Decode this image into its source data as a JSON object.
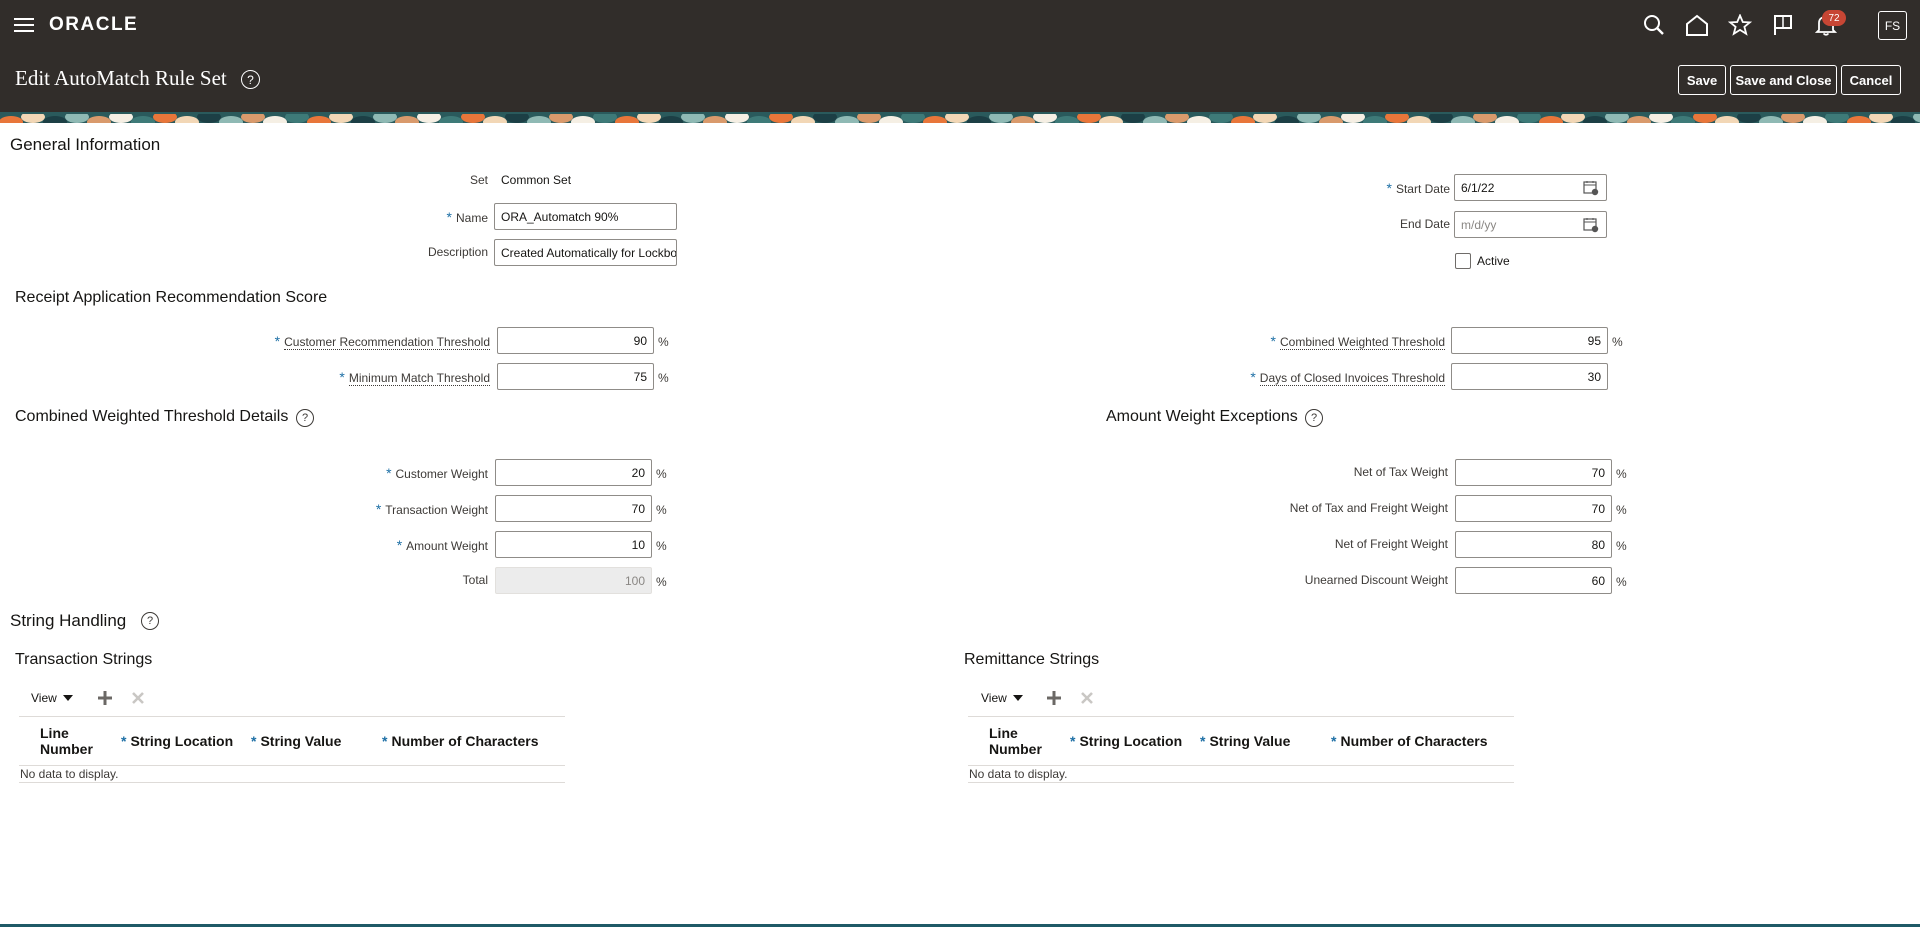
{
  "header": {
    "logo": "ORACLE",
    "notification_count": "72",
    "avatar_initials": "FS",
    "icons": [
      "menu-icon",
      "search-icon",
      "home-icon",
      "star-icon",
      "flag-icon",
      "bell-icon"
    ]
  },
  "page": {
    "title": "Edit AutoMatch Rule Set",
    "help": "?",
    "save_label": "Save",
    "save_close_label": "Save and Close",
    "cancel_label": "Cancel"
  },
  "general": {
    "heading": "General Information",
    "set_label": "Set",
    "set_value": "Common Set",
    "name_label": "Name",
    "name_value": "ORA_Automatch 90%",
    "description_label": "Description",
    "description_value": "Created Automatically for Lockbox",
    "start_date_label": "Start Date",
    "start_date_value": "6/1/22",
    "end_date_label": "End Date",
    "end_date_placeholder": "m/d/yy",
    "active_label": "Active",
    "active_checked": false
  },
  "receipt_score": {
    "heading": "Receipt Application Recommendation Score",
    "customer_rec_label": "Customer Recommendation Threshold",
    "customer_rec_value": "90",
    "min_match_label": "Minimum Match Threshold",
    "min_match_value": "75",
    "combined_weighted_label": "Combined Weighted Threshold",
    "combined_weighted_value": "95",
    "days_closed_label": "Days of Closed Invoices Threshold",
    "days_closed_value": "30",
    "percent": "%"
  },
  "combined_details": {
    "heading": "Combined Weighted Threshold Details",
    "customer_weight_label": "Customer Weight",
    "customer_weight_value": "20",
    "transaction_weight_label": "Transaction Weight",
    "transaction_weight_value": "70",
    "amount_weight_label": "Amount Weight",
    "amount_weight_value": "10",
    "total_label": "Total",
    "total_value": "100"
  },
  "amount_exceptions": {
    "heading": "Amount Weight Exceptions",
    "net_tax_label": "Net of Tax Weight",
    "net_tax_value": "70",
    "net_tax_freight_label": "Net of Tax and Freight Weight",
    "net_tax_freight_value": "70",
    "net_freight_label": "Net of Freight Weight",
    "net_freight_value": "80",
    "unearned_label": "Unearned Discount Weight",
    "unearned_value": "60"
  },
  "string_handling": {
    "heading": "String Handling",
    "transaction": {
      "heading": "Transaction Strings",
      "view_label": "View",
      "columns": [
        "Line Number",
        "String Location",
        "String Value",
        "Number of Characters"
      ],
      "empty": "No data to display."
    },
    "remittance": {
      "heading": "Remittance Strings",
      "view_label": "View",
      "columns": [
        "Line Number",
        "String Location",
        "String Value",
        "Number of Characters"
      ],
      "empty": "No data to display."
    }
  },
  "colors": {
    "header_bg": "#312d2a",
    "required_star": "#1d6fa5",
    "badge": "#c74634"
  }
}
